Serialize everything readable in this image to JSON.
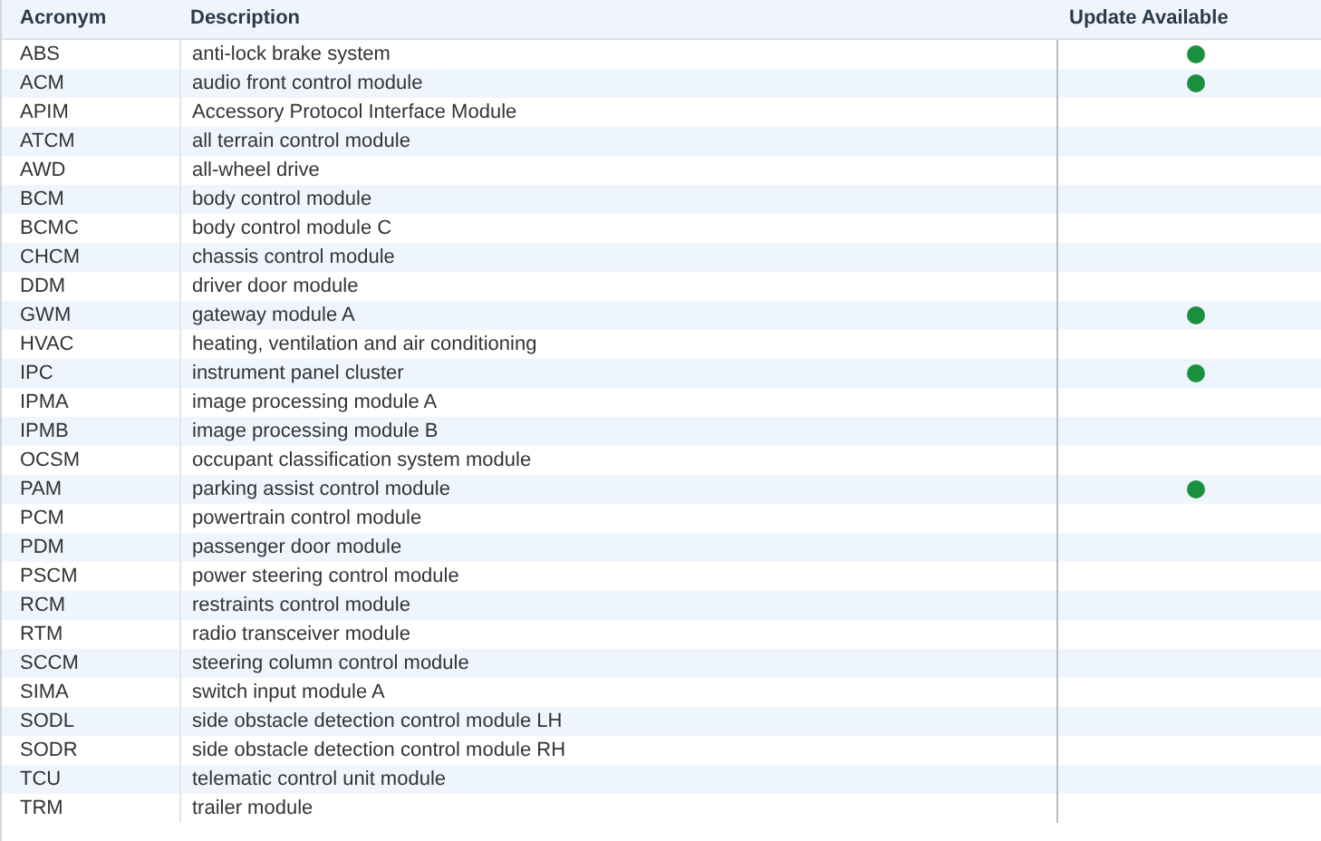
{
  "table": {
    "columns": [
      "Acronym",
      "Description",
      "Update Available"
    ],
    "rows": [
      {
        "acronym": "ABS",
        "description": "anti-lock brake system",
        "update_available": true
      },
      {
        "acronym": "ACM",
        "description": "audio front control module",
        "update_available": true
      },
      {
        "acronym": "APIM",
        "description": "Accessory Protocol Interface Module",
        "update_available": false
      },
      {
        "acronym": "ATCM",
        "description": "all terrain control module",
        "update_available": false
      },
      {
        "acronym": "AWD",
        "description": "all-wheel drive",
        "update_available": false
      },
      {
        "acronym": "BCM",
        "description": "body control module",
        "update_available": false
      },
      {
        "acronym": "BCMC",
        "description": "body control module C",
        "update_available": false
      },
      {
        "acronym": "CHCM",
        "description": "chassis control module",
        "update_available": false
      },
      {
        "acronym": "DDM",
        "description": "driver door module",
        "update_available": false
      },
      {
        "acronym": "GWM",
        "description": "gateway module A",
        "update_available": true
      },
      {
        "acronym": "HVAC",
        "description": "heating, ventilation and air conditioning",
        "update_available": false
      },
      {
        "acronym": "IPC",
        "description": "instrument panel cluster",
        "update_available": true
      },
      {
        "acronym": "IPMA",
        "description": "image processing module A",
        "update_available": false
      },
      {
        "acronym": "IPMB",
        "description": "image processing module B",
        "update_available": false
      },
      {
        "acronym": "OCSM",
        "description": "occupant classification system module",
        "update_available": false
      },
      {
        "acronym": "PAM",
        "description": "parking assist control module",
        "update_available": true
      },
      {
        "acronym": "PCM",
        "description": "powertrain control module",
        "update_available": false
      },
      {
        "acronym": "PDM",
        "description": "passenger door module",
        "update_available": false
      },
      {
        "acronym": "PSCM",
        "description": "power steering control module",
        "update_available": false
      },
      {
        "acronym": "RCM",
        "description": "restraints control module",
        "update_available": false
      },
      {
        "acronym": "RTM",
        "description": "radio transceiver module",
        "update_available": false
      },
      {
        "acronym": "SCCM",
        "description": "steering column control module",
        "update_available": false
      },
      {
        "acronym": "SIMA",
        "description": "switch input module A",
        "update_available": false
      },
      {
        "acronym": "SODL",
        "description": "side obstacle detection control module LH",
        "update_available": false
      },
      {
        "acronym": "SODR",
        "description": "side obstacle detection control module RH",
        "update_available": false
      },
      {
        "acronym": "TCU",
        "description": "telematic control unit module",
        "update_available": false
      },
      {
        "acronym": "TRM",
        "description": "trailer module",
        "update_available": false
      }
    ]
  }
}
